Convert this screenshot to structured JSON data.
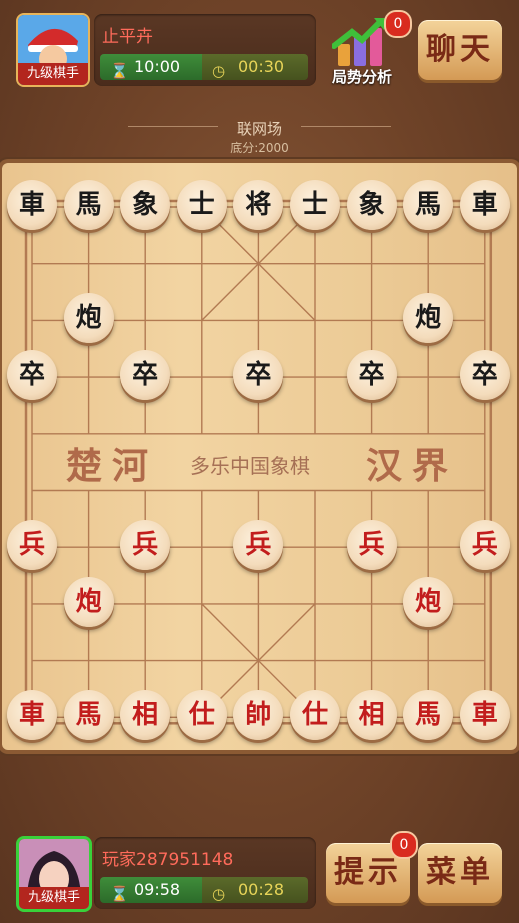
{
  "opponent": {
    "name": "止平卉",
    "rank": "九级棋手",
    "total_time": "10:00",
    "step_time": "00:30"
  },
  "player": {
    "name": "玩家287951148",
    "rank": "九级棋手",
    "total_time": "09:58",
    "step_time": "00:28"
  },
  "analysis": {
    "label": "局势分析",
    "badge": "0"
  },
  "buttons": {
    "chat": "聊天",
    "hint": "提示",
    "hint_badge": "0",
    "menu": "菜单"
  },
  "venue": {
    "name": "联网场",
    "stake": "底分:2000"
  },
  "river": {
    "left": "楚河",
    "center": "多乐中国象棋",
    "right": "汉界"
  },
  "colors": {
    "red_piece": "#c21d1d",
    "black_piece": "#1a1a1a",
    "timer_green": "#3f8d3a"
  },
  "pieces": [
    {
      "id": "b-che-l",
      "side": "black",
      "text": "車",
      "file": 0,
      "rank": 0
    },
    {
      "id": "b-ma-l",
      "side": "black",
      "text": "馬",
      "file": 1,
      "rank": 0
    },
    {
      "id": "b-xiang-l",
      "side": "black",
      "text": "象",
      "file": 2,
      "rank": 0
    },
    {
      "id": "b-shi-l",
      "side": "black",
      "text": "士",
      "file": 3,
      "rank": 0
    },
    {
      "id": "b-jiang",
      "side": "black",
      "text": "将",
      "file": 4,
      "rank": 0
    },
    {
      "id": "b-shi-r",
      "side": "black",
      "text": "士",
      "file": 5,
      "rank": 0
    },
    {
      "id": "b-xiang-r",
      "side": "black",
      "text": "象",
      "file": 6,
      "rank": 0
    },
    {
      "id": "b-ma-r",
      "side": "black",
      "text": "馬",
      "file": 7,
      "rank": 0
    },
    {
      "id": "b-che-r",
      "side": "black",
      "text": "車",
      "file": 8,
      "rank": 0
    },
    {
      "id": "b-pao-l",
      "side": "black",
      "text": "炮",
      "file": 1,
      "rank": 2
    },
    {
      "id": "b-pao-r",
      "side": "black",
      "text": "炮",
      "file": 7,
      "rank": 2
    },
    {
      "id": "b-zu-1",
      "side": "black",
      "text": "卒",
      "file": 0,
      "rank": 3
    },
    {
      "id": "b-zu-2",
      "side": "black",
      "text": "卒",
      "file": 2,
      "rank": 3
    },
    {
      "id": "b-zu-3",
      "side": "black",
      "text": "卒",
      "file": 4,
      "rank": 3
    },
    {
      "id": "b-zu-4",
      "side": "black",
      "text": "卒",
      "file": 6,
      "rank": 3
    },
    {
      "id": "b-zu-5",
      "side": "black",
      "text": "卒",
      "file": 8,
      "rank": 3
    },
    {
      "id": "r-bing-1",
      "side": "red",
      "text": "兵",
      "file": 0,
      "rank": 6
    },
    {
      "id": "r-bing-2",
      "side": "red",
      "text": "兵",
      "file": 2,
      "rank": 6
    },
    {
      "id": "r-bing-3",
      "side": "red",
      "text": "兵",
      "file": 4,
      "rank": 6
    },
    {
      "id": "r-bing-4",
      "side": "red",
      "text": "兵",
      "file": 6,
      "rank": 6
    },
    {
      "id": "r-bing-5",
      "side": "red",
      "text": "兵",
      "file": 8,
      "rank": 6
    },
    {
      "id": "r-pao-l",
      "side": "red",
      "text": "炮",
      "file": 1,
      "rank": 7
    },
    {
      "id": "r-pao-r",
      "side": "red",
      "text": "炮",
      "file": 7,
      "rank": 7
    },
    {
      "id": "r-che-l",
      "side": "red",
      "text": "車",
      "file": 0,
      "rank": 9
    },
    {
      "id": "r-ma-l",
      "side": "red",
      "text": "馬",
      "file": 1,
      "rank": 9
    },
    {
      "id": "r-xiang-l",
      "side": "red",
      "text": "相",
      "file": 2,
      "rank": 9
    },
    {
      "id": "r-shi-l",
      "side": "red",
      "text": "仕",
      "file": 3,
      "rank": 9
    },
    {
      "id": "r-shuai",
      "side": "red",
      "text": "帥",
      "file": 4,
      "rank": 9
    },
    {
      "id": "r-shi-r",
      "side": "red",
      "text": "仕",
      "file": 5,
      "rank": 9
    },
    {
      "id": "r-xiang-r",
      "side": "red",
      "text": "相",
      "file": 6,
      "rank": 9
    },
    {
      "id": "r-ma-r",
      "side": "red",
      "text": "馬",
      "file": 7,
      "rank": 9
    },
    {
      "id": "r-che-r",
      "side": "red",
      "text": "車",
      "file": 8,
      "rank": 9
    }
  ]
}
